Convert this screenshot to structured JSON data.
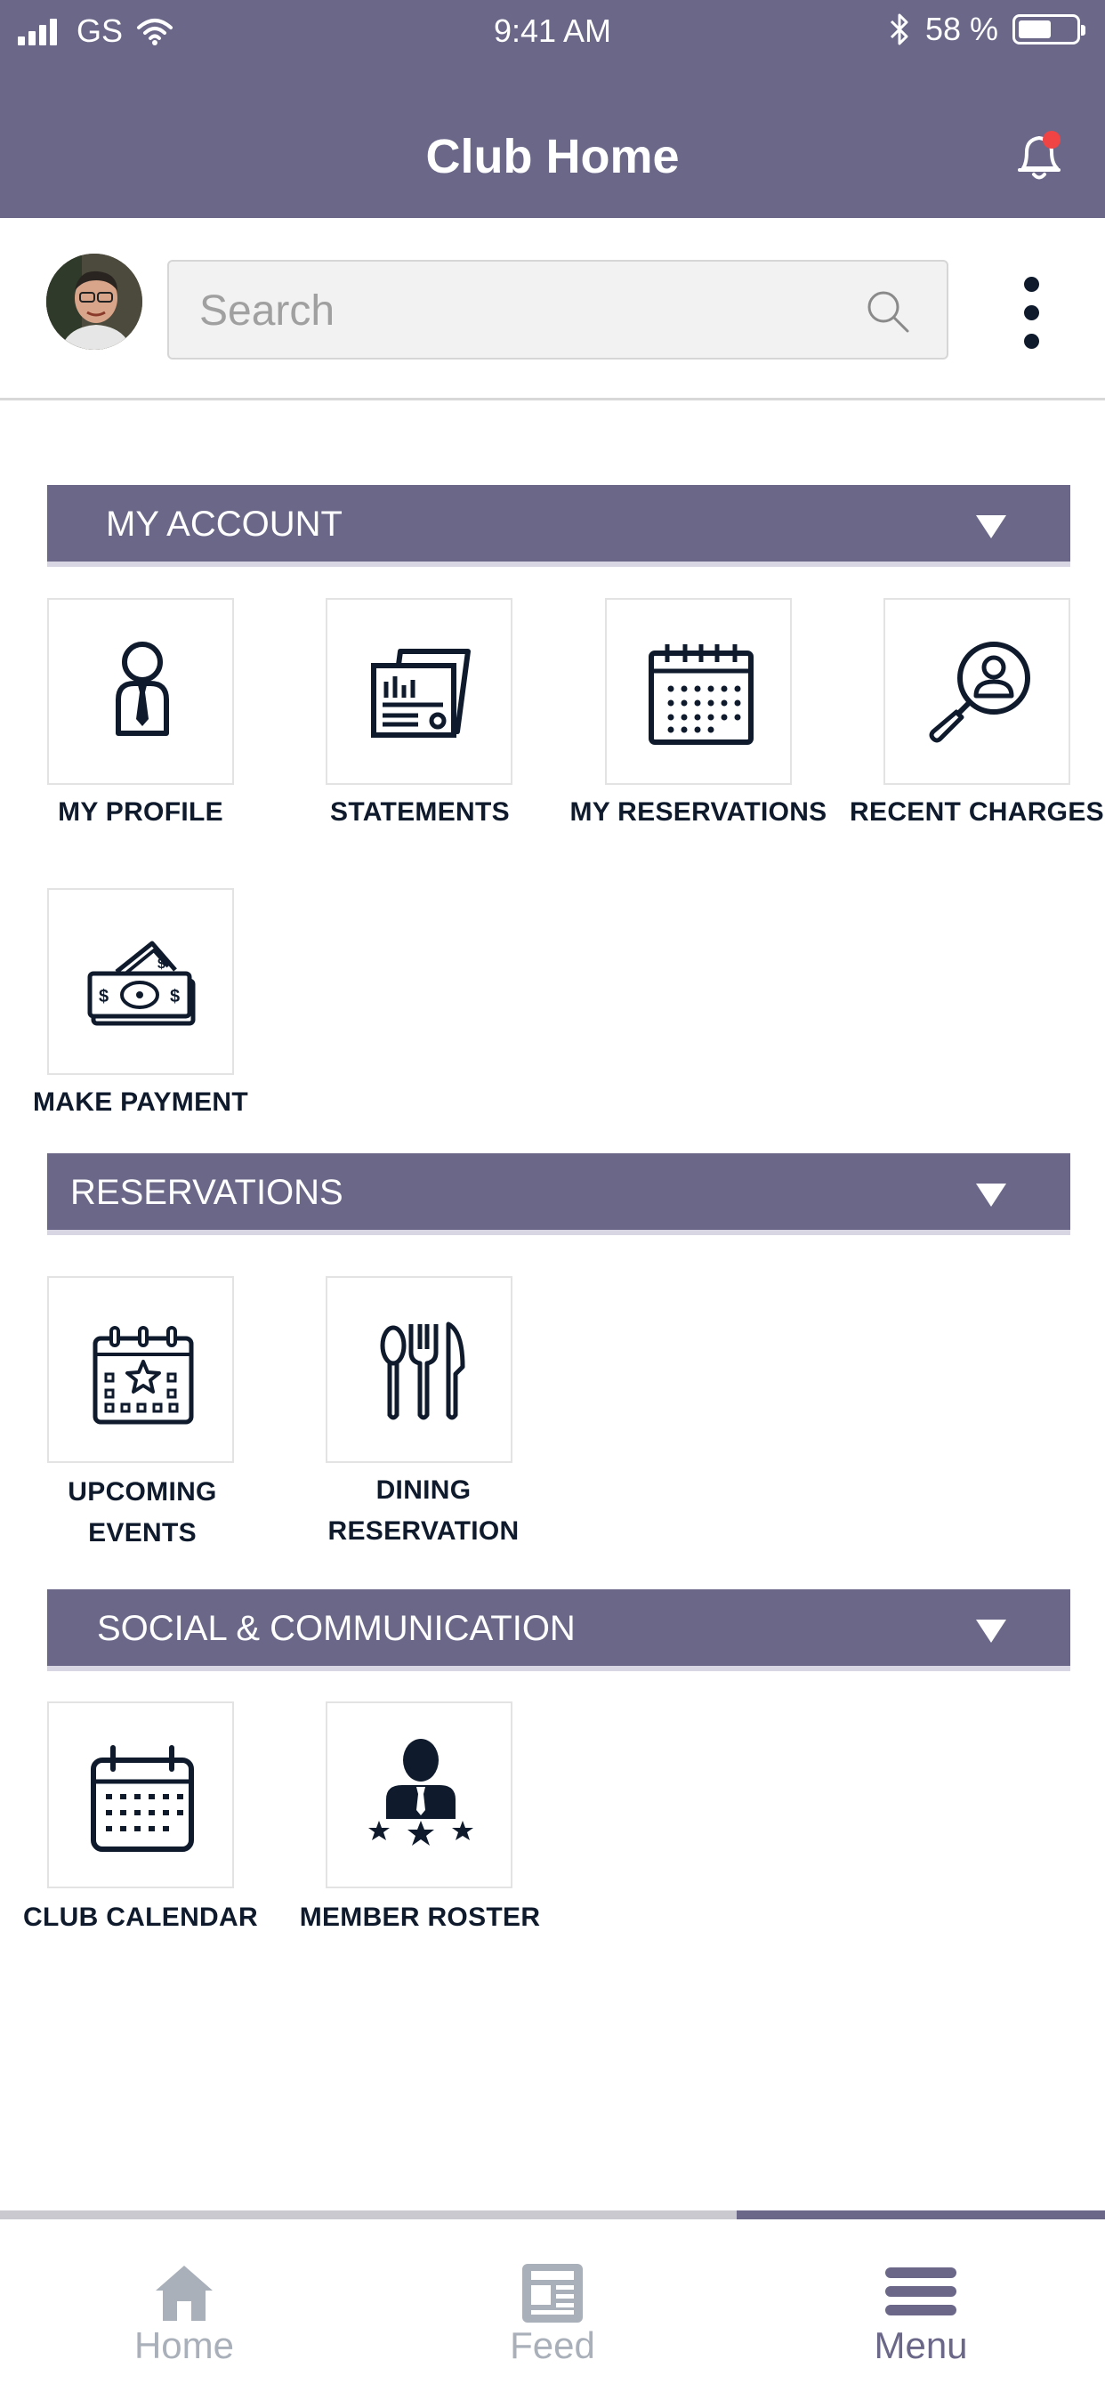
{
  "status_bar": {
    "carrier": "GS",
    "time": "9:41 AM",
    "battery_text": "58 %",
    "battery_level": 0.58
  },
  "header": {
    "title": "Club Home",
    "notification_dot_color": "#f04444"
  },
  "search": {
    "placeholder": "Search"
  },
  "colors": {
    "brand": "#6a6789",
    "icon": "#0f1b2d",
    "inactive_nav": "#aab0b9"
  },
  "sections": {
    "account": {
      "title": "MY ACCOUNT",
      "tiles": {
        "profile": {
          "label": "MY PROFILE",
          "icon": "person-tie-icon"
        },
        "statements": {
          "label": "STATEMENTS",
          "icon": "document-chart-icon"
        },
        "reservations": {
          "label": "MY RESERVATIONS",
          "icon": "calendar-icon"
        },
        "charges": {
          "label": "RECENT CHARGES",
          "icon": "magnifier-person-icon"
        },
        "payment": {
          "label": "MAKE PAYMENT",
          "icon": "money-icon"
        }
      }
    },
    "reservations": {
      "title": "RESERVATIONS",
      "tiles": {
        "events": {
          "label_line1": "UPCOMING",
          "label_line2": "EVENTS",
          "icon": "calendar-star-icon"
        },
        "dining": {
          "label_line1": "DINING",
          "label_line2": "RESERVATION",
          "icon": "cutlery-icon"
        }
      }
    },
    "social": {
      "title": "SOCIAL & COMMUNICATION",
      "tiles": {
        "calendar": {
          "label": "CLUB CALENDAR",
          "icon": "calendar-icon"
        },
        "roster": {
          "label": "MEMBER ROSTER",
          "icon": "member-stars-icon"
        }
      }
    }
  },
  "bottom_nav": {
    "home": "Home",
    "feed": "Feed",
    "menu": "Menu",
    "active": "Menu"
  }
}
